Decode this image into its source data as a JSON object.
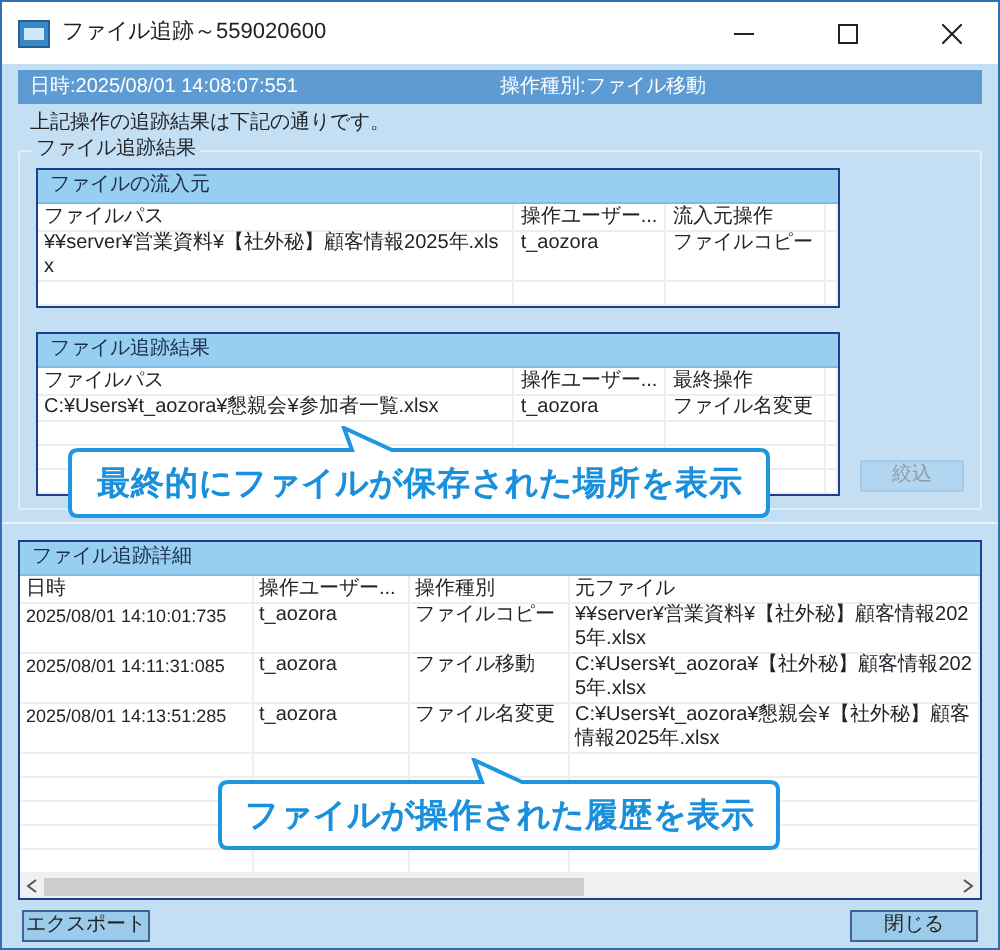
{
  "window": {
    "title": "ファイル追跡～559020600"
  },
  "header": {
    "datetime": "日時:2025/08/01 14:08:07:551",
    "operation": "操作種別:ファイル移動"
  },
  "message": "上記操作の追跡結果は下記の通りです。",
  "tracking_group": {
    "title": "ファイル追跡結果",
    "source_panel": {
      "title": "ファイルの流入元",
      "columns": [
        "ファイルパス",
        "操作ユーザー...",
        "流入元操作"
      ],
      "rows": [
        [
          "¥¥server¥営業資料¥【社外秘】顧客情報2025年.xlsx",
          "t_aozora",
          "ファイルコピー"
        ]
      ]
    },
    "result_panel": {
      "title": "ファイル追跡結果",
      "columns": [
        "ファイルパス",
        "操作ユーザー...",
        "最終操作"
      ],
      "rows": [
        [
          "C:¥Users¥t_aozora¥懇親会¥参加者一覧.xlsx",
          "t_aozora",
          "ファイル名変更"
        ]
      ]
    },
    "filter_button": {
      "label": "絞込",
      "disabled": true
    }
  },
  "detail_panel": {
    "title": "ファイル追跡詳細",
    "columns": [
      "日時",
      "操作ユーザー...",
      "操作種別",
      "元ファイル"
    ],
    "rows": [
      [
        "2025/08/01 14:10:01:735",
        "t_aozora",
        "ファイルコピー",
        "¥¥server¥営業資料¥【社外秘】顧客情報2025年.xlsx"
      ],
      [
        "2025/08/01 14:11:31:085",
        "t_aozora",
        "ファイル移動",
        "C:¥Users¥t_aozora¥【社外秘】顧客情報2025年.xlsx"
      ],
      [
        "2025/08/01 14:13:51:285",
        "t_aozora",
        "ファイル名変更",
        "C:¥Users¥t_aozora¥懇親会¥【社外秘】顧客情報2025年.xlsx"
      ]
    ]
  },
  "callouts": [
    {
      "text": "最終的にファイルが保存された場所を表示"
    },
    {
      "text": "ファイルが操作された履歴を表示"
    }
  ],
  "buttons": {
    "export": "エクスポート",
    "close": "閉じる"
  }
}
